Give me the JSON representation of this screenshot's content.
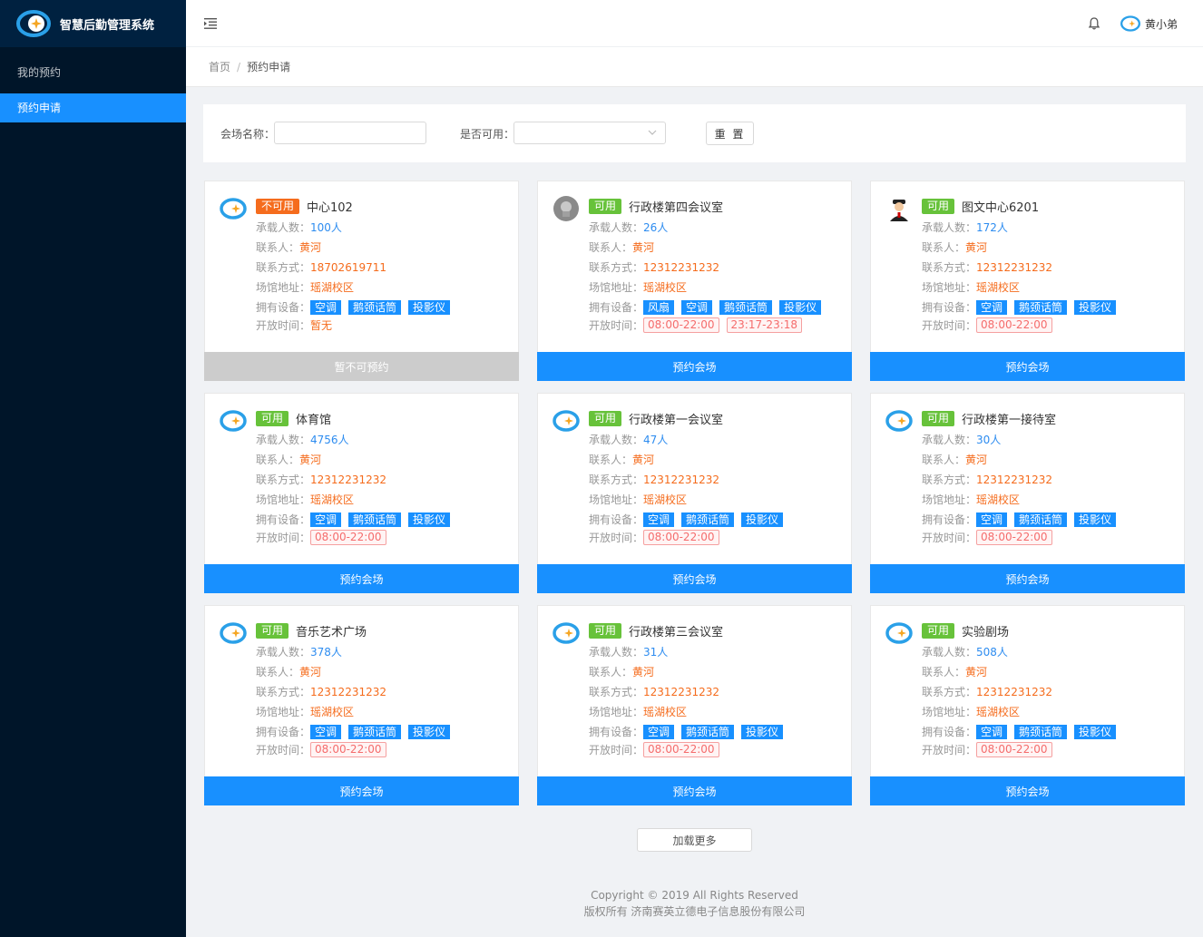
{
  "app": {
    "title": "智慧后勤管理系统"
  },
  "sidebar": {
    "items": [
      {
        "label": "我的预约"
      },
      {
        "label": "预约申请"
      }
    ]
  },
  "header": {
    "user_name": "黄小弟"
  },
  "breadcrumb": {
    "home": "首页",
    "separator": "/",
    "current": "预约申请"
  },
  "filter": {
    "venue_name_label": "会场名称：",
    "venue_name_value": "",
    "available_label": "是否可用：",
    "available_value": "",
    "reset_label": "重 置"
  },
  "labels": {
    "capacity": "承载人数：",
    "contact": "联系人：",
    "phone": "联系方式：",
    "address": "场馆地址：",
    "equipment": "拥有设备：",
    "open_time": "开放时间："
  },
  "cards": [
    {
      "status": "不可用",
      "name": "中心102",
      "capacity": "100人",
      "contact": "黄河",
      "phone": "18702619711",
      "address": "瑶湖校区",
      "equipment": [
        "空调",
        "鹅颈话筒",
        "投影仪"
      ],
      "open_time_text": "暂无",
      "open_times": [],
      "button": "暂不可预约"
    },
    {
      "status": "可用",
      "name": "行政楼第四会议室",
      "capacity": "26人",
      "contact": "黄河",
      "phone": "12312231232",
      "address": "瑶湖校区",
      "equipment": [
        "风扇",
        "空调",
        "鹅颈话筒",
        "投影仪"
      ],
      "open_time_text": "",
      "open_times": [
        "08:00-22:00",
        "23:17-23:18"
      ],
      "button": "预约会场"
    },
    {
      "status": "可用",
      "name": "图文中心6201",
      "capacity": "172人",
      "contact": "黄河",
      "phone": "12312231232",
      "address": "瑶湖校区",
      "equipment": [
        "空调",
        "鹅颈话筒",
        "投影仪"
      ],
      "open_time_text": "",
      "open_times": [
        "08:00-22:00"
      ],
      "button": "预约会场"
    },
    {
      "status": "可用",
      "name": "体育馆",
      "capacity": "4756人",
      "contact": "黄河",
      "phone": "12312231232",
      "address": "瑶湖校区",
      "equipment": [
        "空调",
        "鹅颈话筒",
        "投影仪"
      ],
      "open_time_text": "",
      "open_times": [
        "08:00-22:00"
      ],
      "button": "预约会场"
    },
    {
      "status": "可用",
      "name": "行政楼第一会议室",
      "capacity": "47人",
      "contact": "黄河",
      "phone": "12312231232",
      "address": "瑶湖校区",
      "equipment": [
        "空调",
        "鹅颈话筒",
        "投影仪"
      ],
      "open_time_text": "",
      "open_times": [
        "08:00-22:00"
      ],
      "button": "预约会场"
    },
    {
      "status": "可用",
      "name": "行政楼第一接待室",
      "capacity": "30人",
      "contact": "黄河",
      "phone": "12312231232",
      "address": "瑶湖校区",
      "equipment": [
        "空调",
        "鹅颈话筒",
        "投影仪"
      ],
      "open_time_text": "",
      "open_times": [
        "08:00-22:00"
      ],
      "button": "预约会场"
    },
    {
      "status": "可用",
      "name": "音乐艺术广场",
      "capacity": "378人",
      "contact": "黄河",
      "phone": "12312231232",
      "address": "瑶湖校区",
      "equipment": [
        "空调",
        "鹅颈话筒",
        "投影仪"
      ],
      "open_time_text": "",
      "open_times": [
        "08:00-22:00"
      ],
      "button": "预约会场"
    },
    {
      "status": "可用",
      "name": "行政楼第三会议室",
      "capacity": "31人",
      "contact": "黄河",
      "phone": "12312231232",
      "address": "瑶湖校区",
      "equipment": [
        "空调",
        "鹅颈话筒",
        "投影仪"
      ],
      "open_time_text": "",
      "open_times": [
        "08:00-22:00"
      ],
      "button": "预约会场"
    },
    {
      "status": "可用",
      "name": "实验剧场",
      "capacity": "508人",
      "contact": "黄河",
      "phone": "12312231232",
      "address": "瑶湖校区",
      "equipment": [
        "空调",
        "鹅颈话筒",
        "投影仪"
      ],
      "open_time_text": "",
      "open_times": [
        "08:00-22:00"
      ],
      "button": "预约会场"
    }
  ],
  "load_more": "加载更多",
  "footer": {
    "copyright": "Copyright © 2019 All Rights Reserved",
    "owner": "版权所有 济南赛英立德电子信息股份有限公司"
  },
  "colors": {
    "sidebar_bg": "#001529",
    "primary": "#1890ff",
    "available": "#67c23a",
    "unavailable": "#f56c1d",
    "disabled_button": "#cccccc"
  }
}
